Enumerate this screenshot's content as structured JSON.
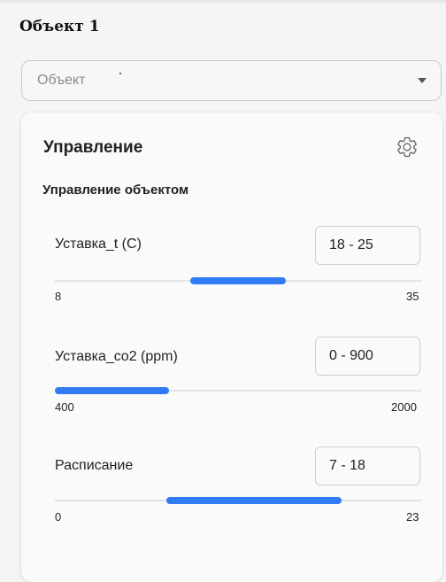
{
  "page": {
    "title": "Объект 1"
  },
  "object_select": {
    "value": "Объект"
  },
  "card": {
    "title": "Управление",
    "settings_icon": "gear-icon",
    "section_title": "Управление объектом"
  },
  "accent_color": "#2f7cf6",
  "controls": [
    {
      "label": "Уставка_t (C)",
      "range_text": "18 - 25",
      "min": 8,
      "max": 35,
      "low": 18,
      "high": 25,
      "min_label": "8",
      "max_label": "35"
    },
    {
      "label": "Уставка_co2 (ppm)",
      "range_text": "0 - 900",
      "min": 400,
      "max": 2000,
      "low": 400,
      "high": 900,
      "min_label": "400",
      "max_label": "2000"
    },
    {
      "label": "Расписание",
      "range_text": "7 - 18",
      "min": 0,
      "max": 23,
      "low": 7,
      "high": 18,
      "min_label": "0",
      "max_label": "23"
    }
  ]
}
